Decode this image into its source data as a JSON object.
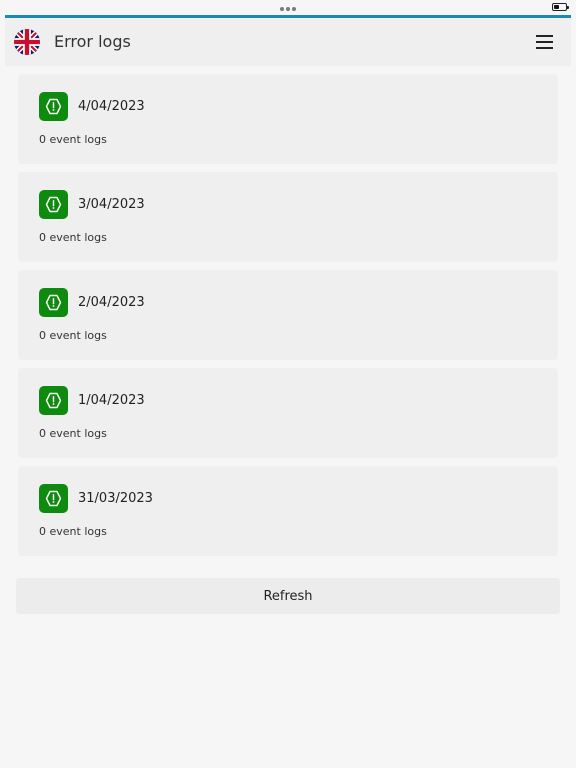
{
  "app_bar": {
    "title": "Error logs",
    "flag_icon": "uk-flag-icon",
    "menu_icon": "hamburger-menu-icon"
  },
  "logs": [
    {
      "date": "4/04/2023",
      "count_label": "0 event logs"
    },
    {
      "date": "3/04/2023",
      "count_label": "0 event logs"
    },
    {
      "date": "2/04/2023",
      "count_label": "0 event logs"
    },
    {
      "date": "1/04/2023",
      "count_label": "0 event logs"
    },
    {
      "date": "31/03/2023",
      "count_label": "0 event logs"
    }
  ],
  "log_icon": "error-warning-icon",
  "refresh_label": "Refresh",
  "colors": {
    "accent": "#1b8ab0",
    "icon_bg": "#0e8a0e",
    "card_bg": "#efefef",
    "page_bg": "#f6f6f6"
  }
}
